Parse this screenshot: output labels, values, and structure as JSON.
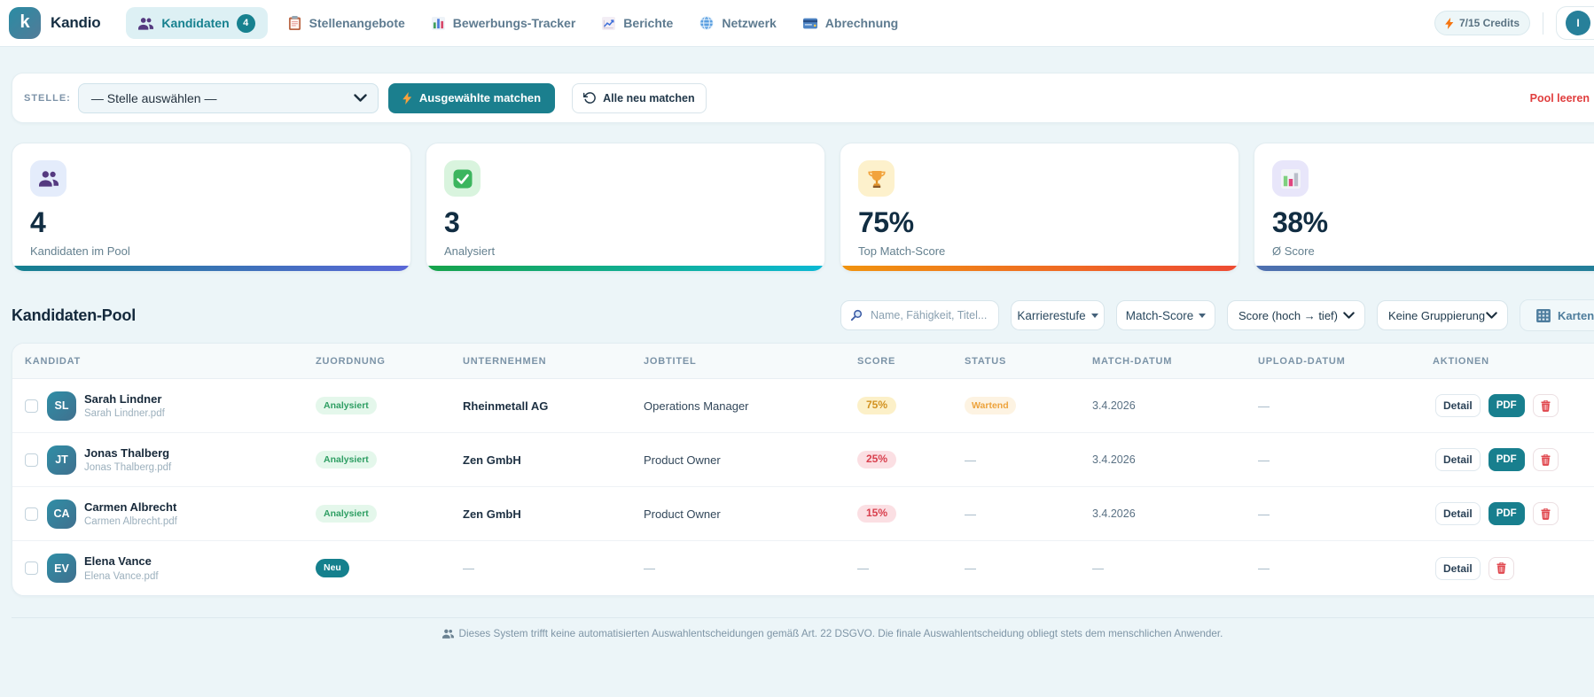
{
  "app": {
    "brand": "Kandio",
    "logo_letter": "k"
  },
  "nav": {
    "items": [
      {
        "label": "Kandidaten",
        "icon": "people-icon",
        "badge": "4",
        "active": true
      },
      {
        "label": "Stellenangebote",
        "icon": "clipboard-icon"
      },
      {
        "label": "Bewerbungs-Tracker",
        "icon": "bar-chart-icon"
      },
      {
        "label": "Berichte",
        "icon": "chart-up-icon"
      },
      {
        "label": "Netzwerk",
        "icon": "globe-icon"
      },
      {
        "label": "Abrechnung",
        "icon": "credit-card-icon"
      }
    ]
  },
  "header_right": {
    "credits": "7/15 Credits",
    "user_initial": "I"
  },
  "match_bar": {
    "label": "STELLE:",
    "job_select_value": "— Stelle auswählen —",
    "match_selected_label": "Ausgewählte matchen",
    "rematch_all_label": "Alle neu matchen",
    "clear_pool_label": "Pool leeren"
  },
  "stats": {
    "cards": [
      {
        "icon": "people-icon",
        "value": "4",
        "label": "Kandidaten im Pool",
        "accent": "teal-indigo"
      },
      {
        "icon": "check-icon",
        "value": "3",
        "label": "Analysiert",
        "accent": "green-cyan"
      },
      {
        "icon": "trophy-icon",
        "value": "75%",
        "label": "Top Match-Score",
        "accent": "orange-red"
      },
      {
        "icon": "bar-chart-icon",
        "value": "38%",
        "label": "Ø Score",
        "accent": "blue-teal"
      }
    ]
  },
  "pool": {
    "title": "Kandidaten-Pool",
    "search_placeholder": "Name, Fähigkeit, Titel...",
    "career_filter_label": "Karrierestufe",
    "score_filter_label": "Match-Score",
    "sort_value": "Score (hoch → tief)",
    "group_value": "Keine Gruppierung",
    "view_toggle_label": "Karten"
  },
  "table": {
    "columns": [
      "Kandidat",
      "Zuordnung",
      "Unternehmen",
      "Jobtitel",
      "Score",
      "Status",
      "Match-Datum",
      "Upload-Datum",
      "Aktionen"
    ],
    "detail_label": "Detail",
    "pdf_label": "PDF",
    "rows": [
      {
        "initials": "SL",
        "name": "Sarah Lindner",
        "file": "Sarah Lindner.pdf",
        "assignment": "Analysiert",
        "assignment_tone": "green",
        "company": "Rheinmetall AG",
        "job": "Operations Manager",
        "score": "75%",
        "score_tone": "amber",
        "status": "Wartend",
        "match_date": "3.4.2026",
        "upload_date": "—"
      },
      {
        "initials": "JT",
        "name": "Jonas Thalberg",
        "file": "Jonas Thalberg.pdf",
        "assignment": "Analysiert",
        "assignment_tone": "green",
        "company": "Zen GmbH",
        "job": "Product Owner",
        "score": "25%",
        "score_tone": "red",
        "status": "—",
        "match_date": "3.4.2026",
        "upload_date": "—"
      },
      {
        "initials": "CA",
        "name": "Carmen Albrecht",
        "file": "Carmen Albrecht.pdf",
        "assignment": "Analysiert",
        "assignment_tone": "green",
        "company": "Zen GmbH",
        "job": "Product Owner",
        "score": "15%",
        "score_tone": "red",
        "status": "—",
        "match_date": "3.4.2026",
        "upload_date": "—"
      },
      {
        "initials": "EV",
        "name": "Elena Vance",
        "file": "Elena Vance.pdf",
        "assignment": "Neu",
        "assignment_tone": "teal",
        "company": "—",
        "job": "—",
        "score": "—",
        "score_tone": "",
        "status": "—",
        "match_date": "—",
        "upload_date": "—"
      }
    ]
  },
  "footer": {
    "disclaimer": "Dieses System trifft keine automatisierten Auswahlentscheidungen gemäß Art. 22 DSGVO. Die finale Auswahlentscheidung obliegt stets dem menschlichen Anwender."
  },
  "colors": {
    "primary_teal": "#17818f",
    "page_bg": "#ecf5f8",
    "danger_red": "#e03e3e",
    "badge_green": "#2e9e63",
    "badge_amber": "#d29220",
    "bolt_orange": "#f5930f"
  }
}
